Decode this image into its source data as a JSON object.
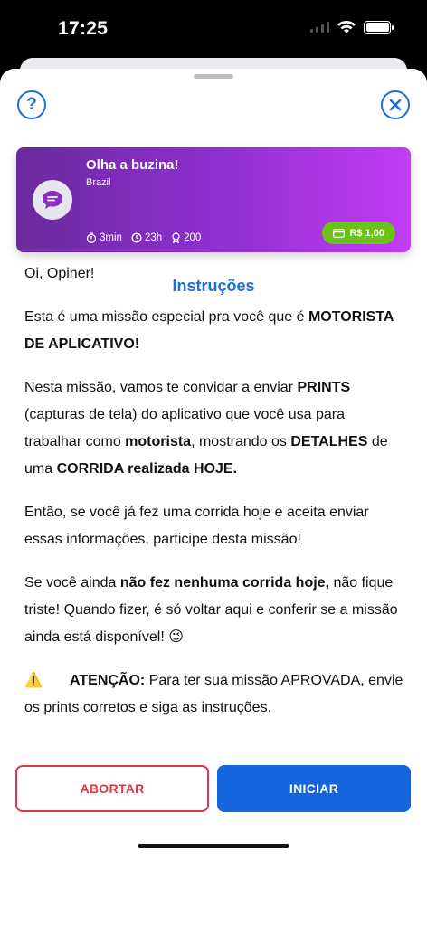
{
  "status_bar": {
    "time": "17:25"
  },
  "card": {
    "title": "Olha a buzina!",
    "subtitle": "Brazil",
    "duration": "3min",
    "deadline": "23h",
    "points": "200",
    "reward": "R$ 1,00"
  },
  "section_title": "Instruções",
  "instructions": {
    "greeting": "Oi, Opiner!",
    "p2_a": "Esta é uma missão especial pra você que é ",
    "p2_b": "MOTORISTA DE APLICATIVO!",
    "p3_a": "Nesta missão, vamos te convidar a enviar ",
    "p3_b": "PRINTS",
    "p3_c": " (capturas de tela) do aplicativo que você usa para trabalhar como ",
    "p3_d": "motorista",
    "p3_e": ", mostrando os ",
    "p3_f": "DETALHES",
    "p3_g": " de uma ",
    "p3_h": "CORRIDA realizada HOJE.",
    "p4": "Então, se você já fez uma corrida hoje e aceita enviar essas informações, participe desta missão!",
    "p5_a": "Se você ainda ",
    "p5_b": "não fez nenhuma corrida hoje,",
    "p5_c": " não fique triste! Quando fizer, é só voltar aqui e conferir se a missão ainda está disponível! 😉",
    "warn_label": "ATENÇÃO:",
    "warn_text": " Para ter sua missão APROVADA, envie os prints corretos e siga as instruções."
  },
  "buttons": {
    "abort": "ABORTAR",
    "start": "INICIAR"
  },
  "colors": {
    "accent": "#1464dc",
    "danger": "#d33a48",
    "reward": "#6cc317"
  }
}
